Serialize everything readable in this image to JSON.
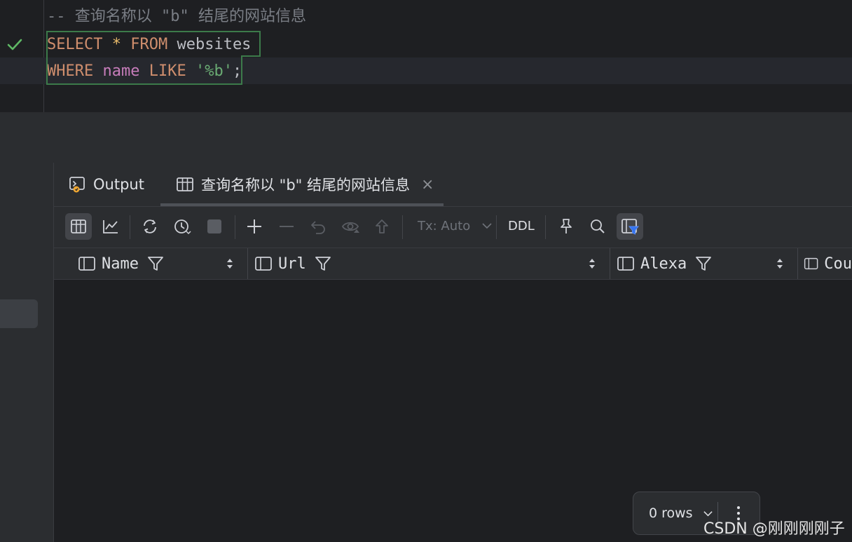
{
  "editor": {
    "comment": "-- 查询名称以 \"b\" 结尾的网站信息",
    "line2": {
      "kw1": "SELECT",
      "star": "*",
      "kw2": "FROM",
      "table": "websites"
    },
    "line3": {
      "kw1": "WHERE",
      "column": "name",
      "kw2": "LIKE",
      "pattern": "'%b'",
      "end": ";"
    }
  },
  "tabs": [
    {
      "label": "Output"
    },
    {
      "label": "查询名称以 \"b\" 结尾的网站信息",
      "close": "×"
    }
  ],
  "toolbar": {
    "tx_label": "Tx: Auto",
    "ddl_label": "DDL"
  },
  "columns": [
    {
      "label": "Name"
    },
    {
      "label": "Url"
    },
    {
      "label": "Alexa"
    },
    {
      "label": "Cou"
    }
  ],
  "status": {
    "rows": "0 rows"
  },
  "watermark": "CSDN @刚刚刚刚子",
  "colors": {
    "keyword": "#cf8e6d",
    "string": "#6aab73",
    "column": "#c77dbb",
    "accent": "#3574f0",
    "ok": "#5fb865"
  }
}
